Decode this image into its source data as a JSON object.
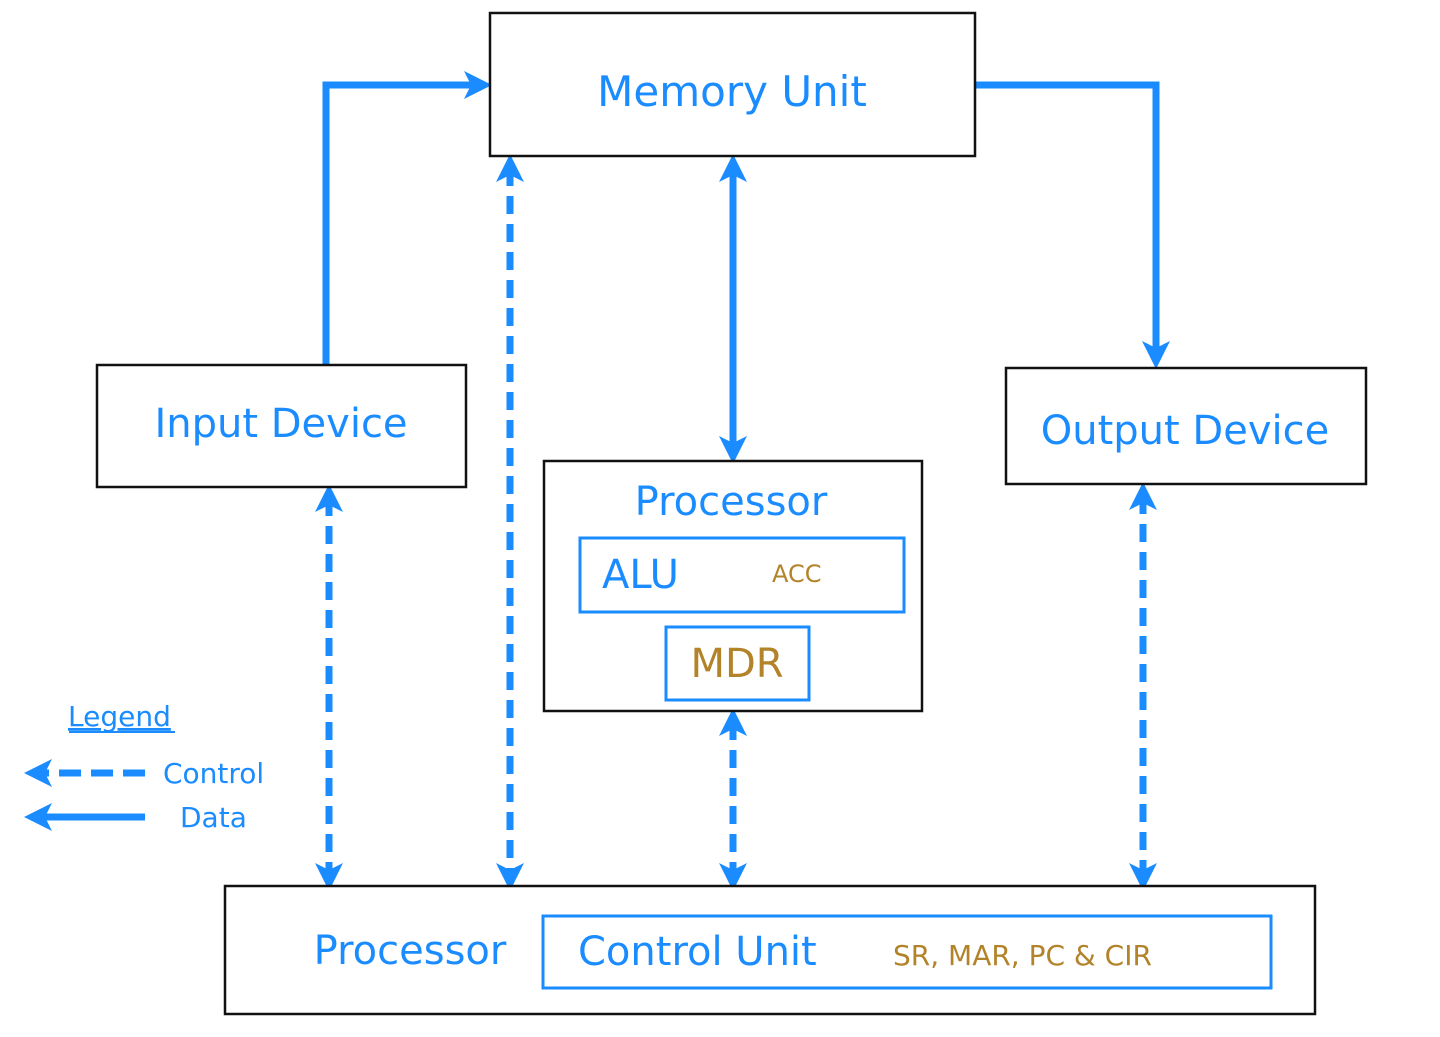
{
  "colors": {
    "accent": "#1a8cff",
    "register_text": "#b3832a",
    "box_border": "#111111"
  },
  "boxes": {
    "memory": "Memory Unit",
    "input": "Input Device",
    "output": "Output Device",
    "processor_top": {
      "title": "Processor",
      "alu": "ALU",
      "acc": "ACC",
      "mdr": "MDR"
    },
    "processor_bottom": {
      "title": "Processor",
      "control_unit": "Control Unit",
      "registers": "SR, MAR, PC & CIR"
    }
  },
  "legend": {
    "title": "Legend",
    "items": [
      {
        "label": "Control",
        "style": "dashed"
      },
      {
        "label": "Data",
        "style": "solid"
      }
    ]
  }
}
